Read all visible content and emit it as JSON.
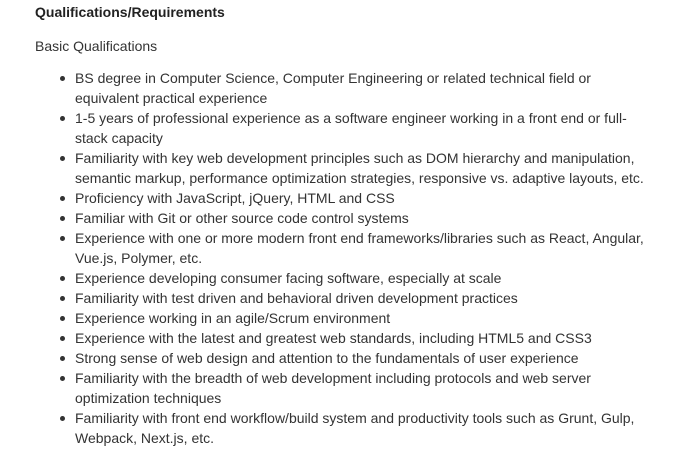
{
  "heading": "Qualifications/Requirements",
  "subheading": "Basic Qualifications",
  "items": [
    "BS degree in Computer Science, Computer Engineering or related technical field or equivalent practical experience",
    "1-5 years of professional experience as a software engineer working in a front end or full-stack capacity",
    "Familiarity with key web development principles such as DOM hierarchy and manipulation, semantic markup, performance optimization strategies, responsive vs. adaptive layouts, etc.",
    "Proficiency with JavaScript, jQuery, HTML and CSS",
    "Familiar with Git or other source code control systems",
    "Experience with one or more modern front end frameworks/libraries such as React, Angular, Vue.js, Polymer, etc.",
    "Experience developing consumer facing software, especially at scale",
    "Familiarity with test driven and behavioral driven development practices",
    "Experience working in an agile/Scrum environment",
    "Experience with the latest and greatest web standards, including HTML5 and CSS3",
    "Strong sense of web design and attention to the fundamentals of user experience",
    "Familiarity with the breadth of web development including protocols and web server optimization techniques",
    "Familiarity with front end workflow/build system and productivity tools such as Grunt, Gulp, Webpack, Next.js, etc."
  ]
}
